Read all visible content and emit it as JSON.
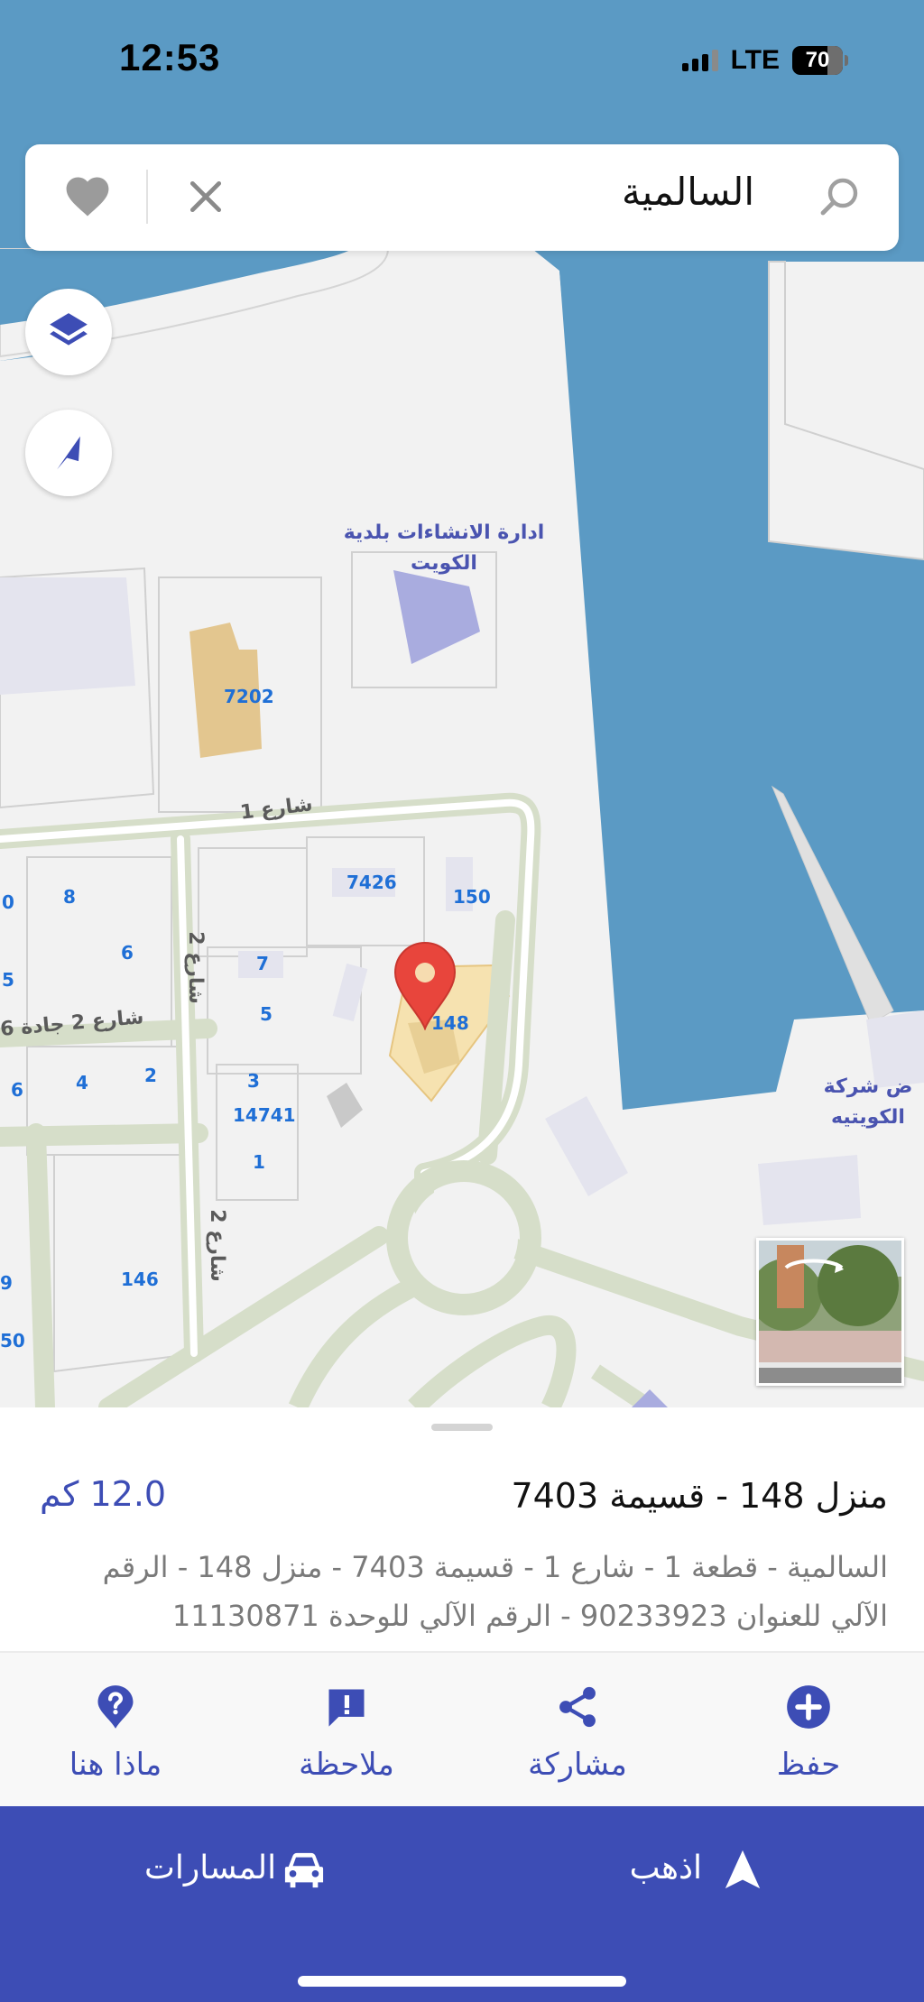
{
  "status_bar": {
    "time": "12:53",
    "network": "LTE",
    "battery": "70",
    "battery_level": 0.7
  },
  "search": {
    "query": "السالمية",
    "icons": [
      "search-icon",
      "clear-icon",
      "heart-icon"
    ]
  },
  "map": {
    "controls": [
      "layers-icon",
      "location-arrow-icon"
    ],
    "parcel_numbers": {
      "p7202": "7202",
      "p7426": "7426",
      "p150": "150",
      "p8": "8",
      "p6a": "6",
      "p0": "0",
      "p5a": "5",
      "p7": "7",
      "p5b": "5",
      "p148": "148",
      "p6b": "6",
      "p4": "4",
      "p2": "2",
      "p3": "3",
      "p14741": "14741",
      "p1": "1",
      "p146": "146",
      "p9": "9",
      "p50": "50"
    },
    "streets": {
      "street1": "شارع 1",
      "street2_vertical_a": "شارع 2",
      "street2_jadda": "شارع 2 جادة 6",
      "street2_vertical_b": "شارع 2"
    },
    "poi": {
      "municipality": "ادارة الانشاءات بلدية الكويت",
      "company": "ض شركة الكويتيه"
    },
    "colors": {
      "water": "#5b9ac4",
      "land": "#f2f2f2",
      "road": "#d6dec9",
      "building": "#a9acdf",
      "highlight": "#f6e2b0",
      "pin": "#e8453c"
    }
  },
  "place": {
    "title": "منزل 148 - قسيمة 7403",
    "distance": "12.0 كم",
    "address": "السالمية - قطعة 1 - شارع 1 - قسيمة 7403 - منزل 148 - الرقم الآلي للعنوان 90233923 - الرقم الآلي للوحدة 11130871"
  },
  "actions": {
    "save": "حفظ",
    "share": "مشاركة",
    "note": "ملاحظة",
    "whats_here": "ماذا هنا"
  },
  "bottom": {
    "go": "اذهب",
    "routes": "المسارات"
  },
  "accent_color": "#3d4db5"
}
